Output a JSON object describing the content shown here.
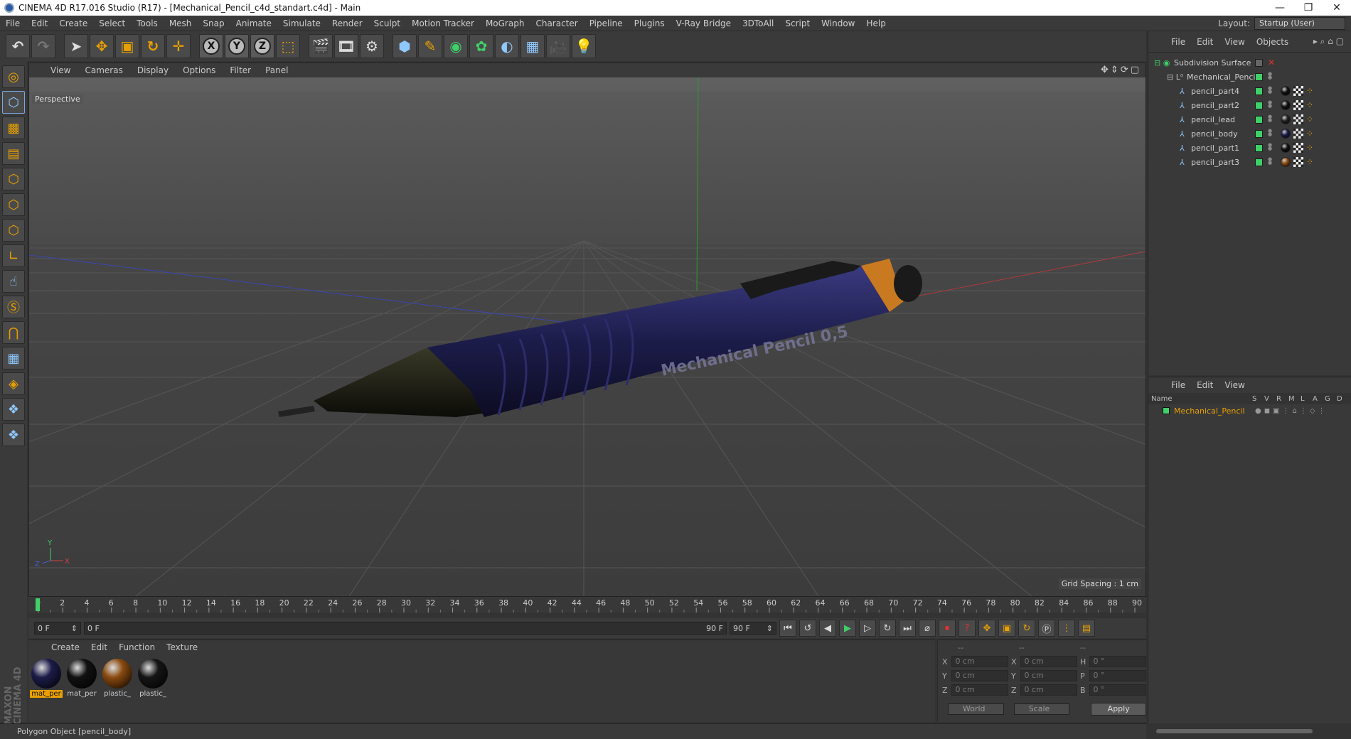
{
  "window": {
    "title": "CINEMA 4D R17.016 Studio (R17) - [Mechanical_Pencil_c4d_standart.c4d] - Main",
    "controls": [
      "—",
      "❐",
      "✕"
    ]
  },
  "menubar": {
    "items": [
      "File",
      "Edit",
      "Create",
      "Select",
      "Tools",
      "Mesh",
      "Snap",
      "Animate",
      "Simulate",
      "Render",
      "Sculpt",
      "Motion Tracker",
      "MoGraph",
      "Character",
      "Pipeline",
      "Plugins",
      "V-Ray Bridge",
      "3DToAll",
      "Script",
      "Window",
      "Help"
    ],
    "layout_label": "Layout:",
    "layout_value": "Startup (User)"
  },
  "viewport": {
    "menu": [
      "View",
      "Cameras",
      "Display",
      "Options",
      "Filter",
      "Panel"
    ],
    "label": "Perspective",
    "grid_spacing": "Grid Spacing : 1 cm",
    "object_text": "Mechanical Pencil 0,5"
  },
  "timeline": {
    "ticks": [
      "0",
      "2",
      "4",
      "6",
      "8",
      "10",
      "12",
      "14",
      "16",
      "18",
      "20",
      "22",
      "24",
      "26",
      "28",
      "30",
      "32",
      "34",
      "36",
      "38",
      "40",
      "42",
      "44",
      "46",
      "48",
      "50",
      "52",
      "54",
      "56",
      "58",
      "60",
      "62",
      "64",
      "66",
      "68",
      "70",
      "72",
      "74",
      "76",
      "78",
      "80",
      "82",
      "84",
      "86",
      "88",
      "90"
    ],
    "current_frame": "0 F",
    "range_start": "0 F",
    "range_end_inner": "90 F",
    "range_end": "90 F"
  },
  "materials": {
    "menu": [
      "Create",
      "Edit",
      "Function",
      "Texture"
    ],
    "items": [
      {
        "name": "mat_per",
        "color": "#1c1c4a",
        "active": true
      },
      {
        "name": "mat_per",
        "color": "#111111",
        "active": false
      },
      {
        "name": "plastic_",
        "color": "#8a4a10",
        "active": false
      },
      {
        "name": "plastic_",
        "color": "#151515",
        "active": false
      }
    ]
  },
  "coordinates": {
    "header": [
      "--",
      "--",
      "--"
    ],
    "rows": [
      {
        "a": "X",
        "v1": "0 cm",
        "b": "X",
        "v2": "0 cm",
        "c": "H",
        "v3": "0 °"
      },
      {
        "a": "Y",
        "v1": "0 cm",
        "b": "Y",
        "v2": "0 cm",
        "c": "P",
        "v3": "0 °"
      },
      {
        "a": "Z",
        "v1": "0 cm",
        "b": "Z",
        "v2": "0 cm",
        "c": "B",
        "v3": "0 °"
      }
    ],
    "mode": "World",
    "transform": "Scale",
    "apply": "Apply"
  },
  "status": "Polygon Object [pencil_body]",
  "brand": "MAXON CINEMA 4D",
  "objects": {
    "menu": [
      "File",
      "Edit",
      "View",
      "Objects"
    ],
    "tree": [
      {
        "name": "Subdivision Surface",
        "level": 0
      },
      {
        "name": "Mechanical_Pencil",
        "level": 1
      },
      {
        "name": "pencil_part4",
        "level": 2,
        "mat": "#111"
      },
      {
        "name": "pencil_part2",
        "level": 2,
        "mat": "#111"
      },
      {
        "name": "pencil_lead",
        "level": 2,
        "mat": "#222"
      },
      {
        "name": "pencil_body",
        "level": 2,
        "mat": "#1c1c4a"
      },
      {
        "name": "pencil_part1",
        "level": 2,
        "mat": "#111"
      },
      {
        "name": "pencil_part3",
        "level": 2,
        "mat": "#8a4a10"
      }
    ]
  },
  "attributes": {
    "menu": [
      "File",
      "Edit",
      "View"
    ],
    "columns": [
      "Name",
      "S",
      "V",
      "R",
      "M",
      "L",
      "A",
      "G",
      "D"
    ],
    "row": "Mechanical_Pencil"
  }
}
